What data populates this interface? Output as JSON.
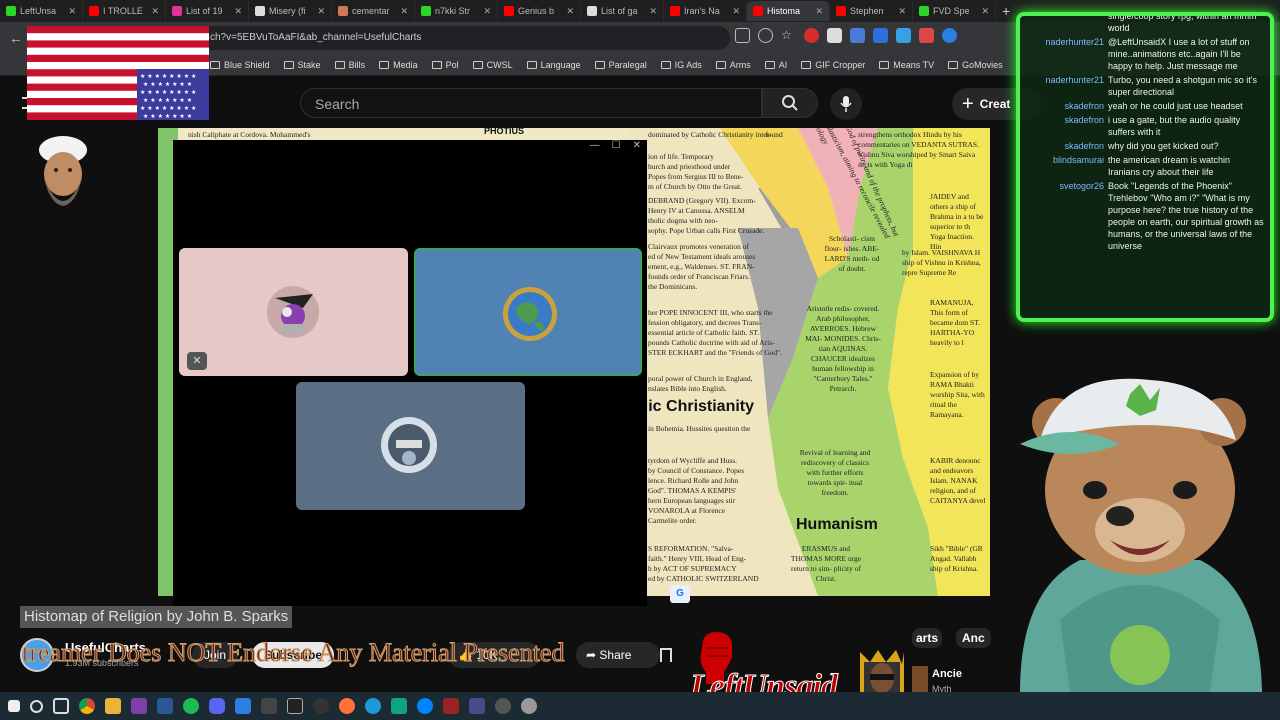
{
  "browser": {
    "tabs": [
      {
        "label": "LeftUnsa",
        "color": "#2bd62b",
        "active": false
      },
      {
        "label": "I TROLLE",
        "color": "#ff0000",
        "active": false
      },
      {
        "label": "List of 19",
        "color": "#e0339a",
        "active": false
      },
      {
        "label": "Misery (fi",
        "color": "#dddddd",
        "active": false
      },
      {
        "label": "cementar",
        "color": "#d4775a",
        "active": false
      },
      {
        "label": "n7kki Str",
        "color": "#2bd62b",
        "active": false
      },
      {
        "label": "Genius b",
        "color": "#ff0000",
        "active": false
      },
      {
        "label": "List of ga",
        "color": "#dddddd",
        "active": false
      },
      {
        "label": "Iran's Na",
        "color": "#ff0000",
        "active": false
      },
      {
        "label": "Histoma",
        "color": "#ff0000",
        "active": true
      },
      {
        "label": "Stephen",
        "color": "#ff0000",
        "active": false
      },
      {
        "label": "FVD Spe",
        "color": "#2bd62b",
        "active": false
      }
    ],
    "url": "ch?v=5EBVuToAaFI&ab_channel=UsefulCharts",
    "bookmarks": [
      "Blue Shield",
      "Stake",
      "Bills",
      "Media",
      "Pol",
      "CWSL",
      "Language",
      "Paralegal",
      "IG Ads",
      "Arms",
      "AI",
      "GIF Cropper",
      "Means TV",
      "GoMovies"
    ]
  },
  "youtube": {
    "search_placeholder": "Search",
    "create_label": "Creat",
    "video_title": "Histomap of Religion by John B. Sparks",
    "channel_name": "UsefulCharts",
    "subscribers": "1.93M subscribers",
    "join_label": "Join",
    "subscribe_label": "Subscribe",
    "likes": "10K",
    "share_label": "Share",
    "right_chips": [
      "arts",
      "Anc"
    ],
    "right_video_title": "Ancie",
    "right_video_sub": "Myth"
  },
  "map": {
    "heading_catholic": "olic Christianity",
    "heading_humanism": "Humanism",
    "heading_photius": "PHOTIUS",
    "text_blocks": [
      "nish Caliphate at Cordova. Mohammed's",
      "dominated by Catholic Christianity inter-",
      "ion of life. Temporary",
      "hurch and priesthood under",
      "Popes from Sergius III to Bene-",
      "m of Church by Otto the Great.",
      "DEBRAND (Gregory VII). Excom-",
      "Henry IV at Canossa. ANSELM",
      "tholic dogma with neo-",
      "sophy. Pope Urban calls First Crusade.",
      "Clairvaux promotes veneration of",
      "ed of New Testament ideals arouses",
      "ement, e.g., Waldenses. ST. FRAN-",
      "founds order of Franciscan Friars.",
      "the Dominicans.",
      "her POPE INNOCENT III, who starts the",
      "fession obligatory, and decrees Trans-",
      "essential article of Catholic faith. ST.",
      "pounds Catholic doctrine with aid of Aris-",
      "STER ECKHART and the \"Friends of God\".",
      "poral power of Church in England,",
      "nslates Bible into English.",
      "in Bohemia. Hussites question the",
      "tyrdom of Wycliffe and Huss.",
      "by Council of Constance. Popes",
      "lence. Richard Rolle and John",
      "God\". THOMAS A KEMPIS'",
      "hern European languages stir",
      "VONAROLA at Florence",
      "Carmelite order.",
      "S REFORMATION. \"Salva-",
      "faith.\" Henry VIII, Head of Eng-",
      "h by ACT OF SUPREMACY",
      "ed by CATHOLIC SWITZERLAND"
    ],
    "mid_blocks": [
      "found",
      "Scholasti- cism flour- ishes. ABE- LARD'S meth- od of doubt.",
      "Aristotle redis- covered. Arab philosopher, AVERROES. Hebrew MAI- MONIDES. Chris- tian AQUINAS. CHAUCER idealizes human fellowship in \"Canterbury Tales.\" Petrarch.",
      "Revival of learning and rediscovery of classics with further efforts towards spir- itual freedom.",
      "ERASMUS and THOMAS MORE urge return to sim- plicity of Christ."
    ],
    "right_blocks": [
      "strengthens orthodox Hindu by his commentaries on VEDANTA SUTRAS. Vishnu Siva worshiped by Smart Saiva sects with Yoga di",
      "JAIDEV and others a ship of Brahma in a to be superior to th Yoga Inaction. Hin",
      "by Islam. VAISHNAVA H ship of Vishnu in Krishna, repre Supreme Re",
      "RAMANUJA, This form of became dom ST. HARTHA-YO heavily to l",
      "Expansion of by RAMA Bhakti worship Sita, with ritual the Ramayana.",
      "KABIR denounc and endeavors Islam. NANAK religion, and of CAITANYA devel",
      "Sikh \"Bible\" (GR Angad. Vallabh ship of Krishna."
    ],
    "diagonal_labels": [
      "Scholasticism, aiming to reconcile revealed theology",
      "God of purity and of the prophets, but"
    ]
  },
  "call_window": {
    "controls": [
      "—",
      "☐",
      "✕"
    ],
    "participants": [
      {
        "name": "participant-1",
        "bg": "#e6c8c8"
      },
      {
        "name": "participant-2",
        "bg": "#5082b4",
        "speaking": true
      },
      {
        "name": "participant-3",
        "bg": "#5a6f83"
      }
    ]
  },
  "chat": {
    "messages": [
      {
        "user": "",
        "text": "single/coop story rpg, within an mmm world"
      },
      {
        "user": "naderhunter21",
        "text": "@LeftUnsaidX I use a lot of stuff on mine..animations etc..again I'll be happy to help. Just message me"
      },
      {
        "user": "naderhunter21",
        "text": "Turbo, you need a shotgun mic so it's super directional"
      },
      {
        "user": "skadefron",
        "text": "yeah or he could just use headset"
      },
      {
        "user": "skadefron",
        "text": "i use a gate, but the audio quality suffers with it"
      },
      {
        "user": "skadefron",
        "text": "why did you get kicked out?"
      },
      {
        "user": "blindsamurai",
        "text": "the american dream is watchin Iranians cry about their life"
      },
      {
        "user": "svetogor26",
        "text": "Book \"Legends of the Phoenix\" Trehlebov \"Who am i?\" \"What is my purpose here? the true history of the people on earth, our spiritual growth as humans, or the universal laws of the universe"
      }
    ]
  },
  "overlay": {
    "disclaimer": "treamer Does NOT Endorse Any Material Presented",
    "logo": "LeftUnsaid"
  },
  "colors": {
    "chat_border": "#4ef24e",
    "logo_red": "#bb0000",
    "map_green": "#8fcf5a",
    "map_yellow": "#f3e45a",
    "map_pink": "#f1b2b7",
    "map_gray": "#a9a9a9"
  }
}
